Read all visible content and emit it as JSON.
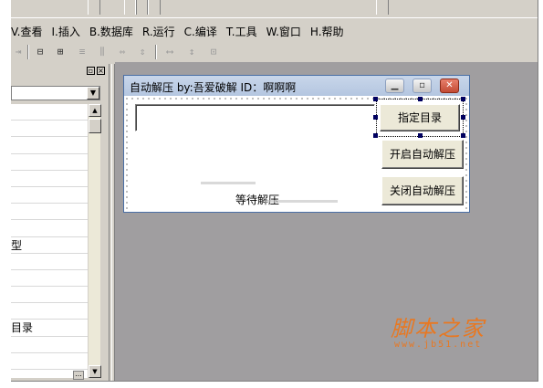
{
  "menubar": {
    "items": [
      {
        "label": "V.查看"
      },
      {
        "label": "I.插入"
      },
      {
        "label": "B.数据库"
      },
      {
        "label": "R.运行"
      },
      {
        "label": "C.编译"
      },
      {
        "label": "T.工具"
      },
      {
        "label": "W.窗口"
      },
      {
        "label": "H.帮助"
      }
    ]
  },
  "left_panel": {
    "minimize_glyph": "▫",
    "close_glyph": "×",
    "visible_rows": [
      "",
      "",
      "",
      "",
      "",
      "",
      "",
      "",
      "型",
      "",
      "",
      "",
      "",
      "目录",
      "",
      ""
    ],
    "ellipsis": "..."
  },
  "form_window": {
    "title": "自动解压 by:吾爱破解 ID：啊啊啊",
    "dir_input_value": "",
    "button_set_dir": "指定目录",
    "button_start": "开启自动解压",
    "button_stop": "关闭自动解压",
    "status_label": "等待解压"
  },
  "watermark": {
    "text": "脚本之家",
    "url": "www.jb51.net"
  },
  "colors": {
    "workspace": "#a09ea0",
    "chrome": "#d4d0c8",
    "watermark": "#e87822",
    "close_button": "#c24a34"
  }
}
